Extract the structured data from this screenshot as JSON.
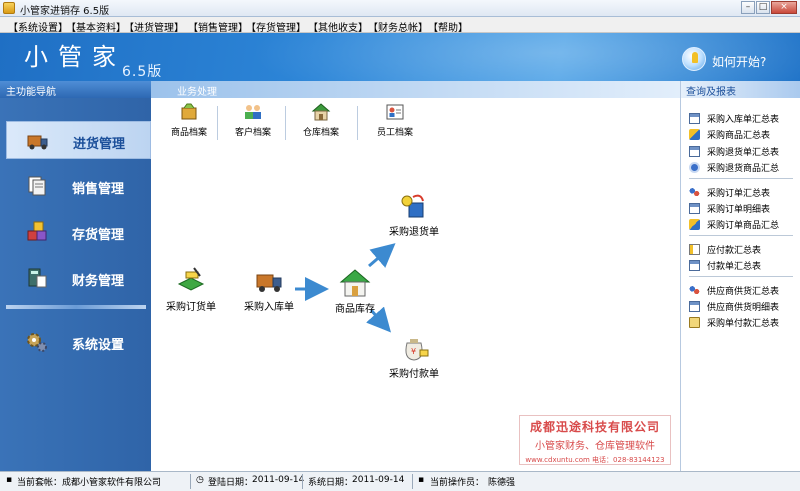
{
  "window": {
    "title": "小管家进销存 6.5版",
    "minimize": "–",
    "maximize": "□",
    "close": "×"
  },
  "menu": [
    "【系统设置】",
    "【基本资料】",
    "【进货管理】",
    "【销售管理】",
    "【存货管理】",
    "【其他收支】",
    "【财务总帐】",
    "【帮助】"
  ],
  "banner": {
    "app_name": "小管家",
    "version": "6.5版",
    "help_link": "如何开始?"
  },
  "sidebar": {
    "title": "主功能导航",
    "items": [
      {
        "label": "进货管理",
        "icon": "truck-icon",
        "active": true
      },
      {
        "label": "销售管理",
        "icon": "documents-icon",
        "active": false
      },
      {
        "label": "存货管理",
        "icon": "boxes-icon",
        "active": false
      },
      {
        "label": "财务管理",
        "icon": "calculator-icon",
        "active": false
      },
      {
        "label": "系统设置",
        "icon": "gears-icon",
        "active": false
      }
    ]
  },
  "main": {
    "title": "业务处理",
    "toolbar": [
      "商品档案",
      "客户档案",
      "仓库档案",
      "员工档案"
    ],
    "flow": {
      "purchase_order": "采购订货单",
      "purchase_receipt": "采购入库单",
      "inventory": "商品库存",
      "purchase_return": "采购退货单",
      "purchase_payment": "采购付款单"
    }
  },
  "right": {
    "title": "查询及报表",
    "groups": [
      [
        "采购入库单汇总表",
        "采购商品汇总表",
        "采购退货单汇总表",
        "采购退货商品汇总"
      ],
      [
        "采购订单汇总表",
        "采购订单明细表",
        "采购订单商品汇总"
      ],
      [
        "应付款汇总表",
        "付款单汇总表"
      ],
      [
        "供应商供货汇总表",
        "供应商供货明细表",
        "采购单付款汇总表"
      ]
    ]
  },
  "company": {
    "name": "成都迅途科技有限公司",
    "slogan": "小管家财务、仓库管理软件",
    "contact": "www.cdxuntu.com 电话：028-83144123"
  },
  "status": {
    "account_label": "当前套帐：",
    "account_value": "成都小管家软件有限公司",
    "login_label": "登陆日期：",
    "login_value": "2011-09-14",
    "system_label": "系统日期：",
    "system_value": "2011-09-14",
    "operator_label": "当前操作员：",
    "operator_value": "陈德强"
  },
  "colors": {
    "accent": "#2d86d8",
    "sidebar": "#3a73b8",
    "brand_red": "#d84b4b"
  }
}
